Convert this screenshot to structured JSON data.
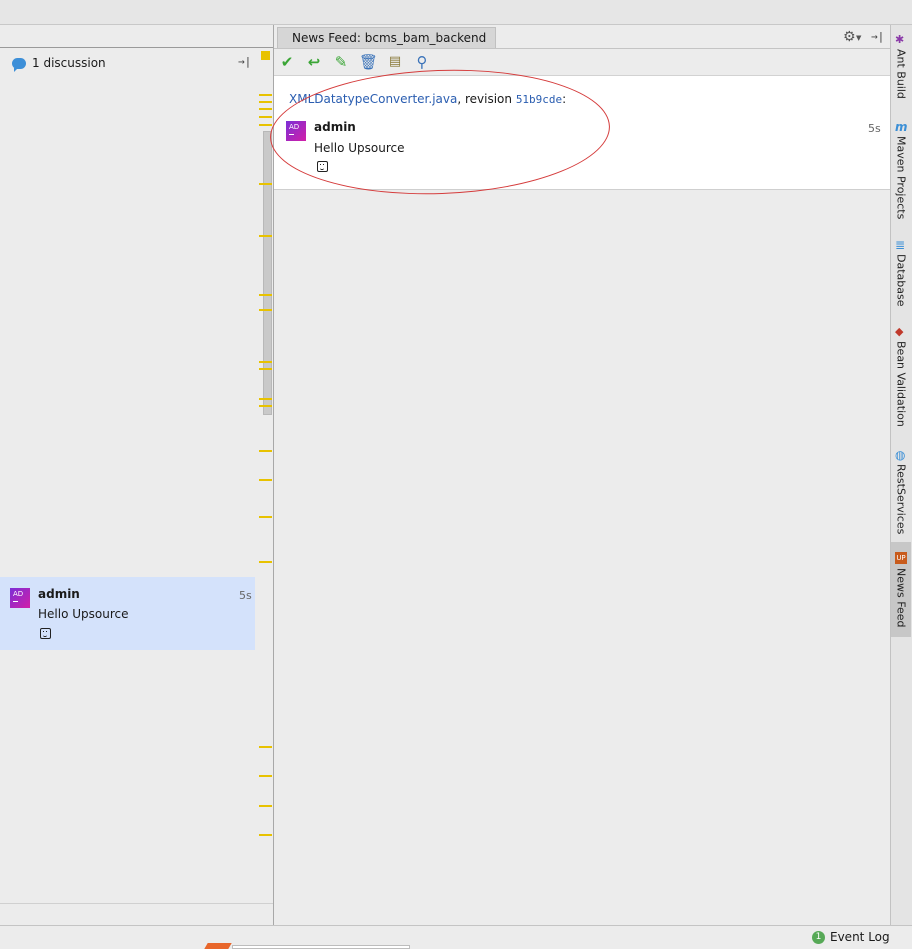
{
  "left_panel": {
    "discussion_count_label": "1 discussion",
    "pin_icon": "pin-right-icon",
    "comment": {
      "avatar_initials": "AD",
      "author": "admin",
      "time": "5s",
      "text": "Hello Upsource",
      "reaction_icon": "smiley-icon"
    }
  },
  "news_feed": {
    "tab_label": "News Feed: bcms_bam_backend",
    "toolbar": [
      {
        "name": "resolve-icon",
        "glyph": "✔",
        "color": "#3aa535"
      },
      {
        "name": "reply-icon",
        "glyph": "↩",
        "color": "#3aa535"
      },
      {
        "name": "edit-icon",
        "glyph": "✎",
        "color": "#3aa535"
      },
      {
        "name": "delete-icon",
        "glyph": "🗑",
        "color": "#3b73b9"
      },
      {
        "name": "spellcheck-icon",
        "glyph": "▤",
        "color": "#8a7a3a"
      },
      {
        "name": "find-icon",
        "glyph": "⚲",
        "color": "#3b73b9"
      }
    ],
    "header": {
      "file": "XMLDatatypeConverter.java",
      "separator": ", revision ",
      "revision": "51b9cde",
      "suffix": ":"
    },
    "comment": {
      "avatar_initials": "AD",
      "author": "admin",
      "time": "5s",
      "text": "Hello Upsource",
      "reaction_icon": "smiley-icon"
    }
  },
  "right_toolbar": [
    {
      "label": "Ant Build",
      "icon": "ant-icon"
    },
    {
      "label": "Maven Projects",
      "icon": "maven-icon"
    },
    {
      "label": "Database",
      "icon": "database-icon"
    },
    {
      "label": "Bean Validation",
      "icon": "bean-validation-icon"
    },
    {
      "label": "RestServices",
      "icon": "rest-services-icon"
    },
    {
      "label": "News Feed",
      "icon": "upsource-icon"
    }
  ],
  "status_bar": {
    "event_log_label": "Event Log",
    "event_count": "1"
  },
  "colors": {
    "accent_link": "#2a5db0",
    "highlight_annotation": "#d53c3c",
    "selected_card": "#d4e2fb",
    "gutter_marker": "#e8c200"
  }
}
